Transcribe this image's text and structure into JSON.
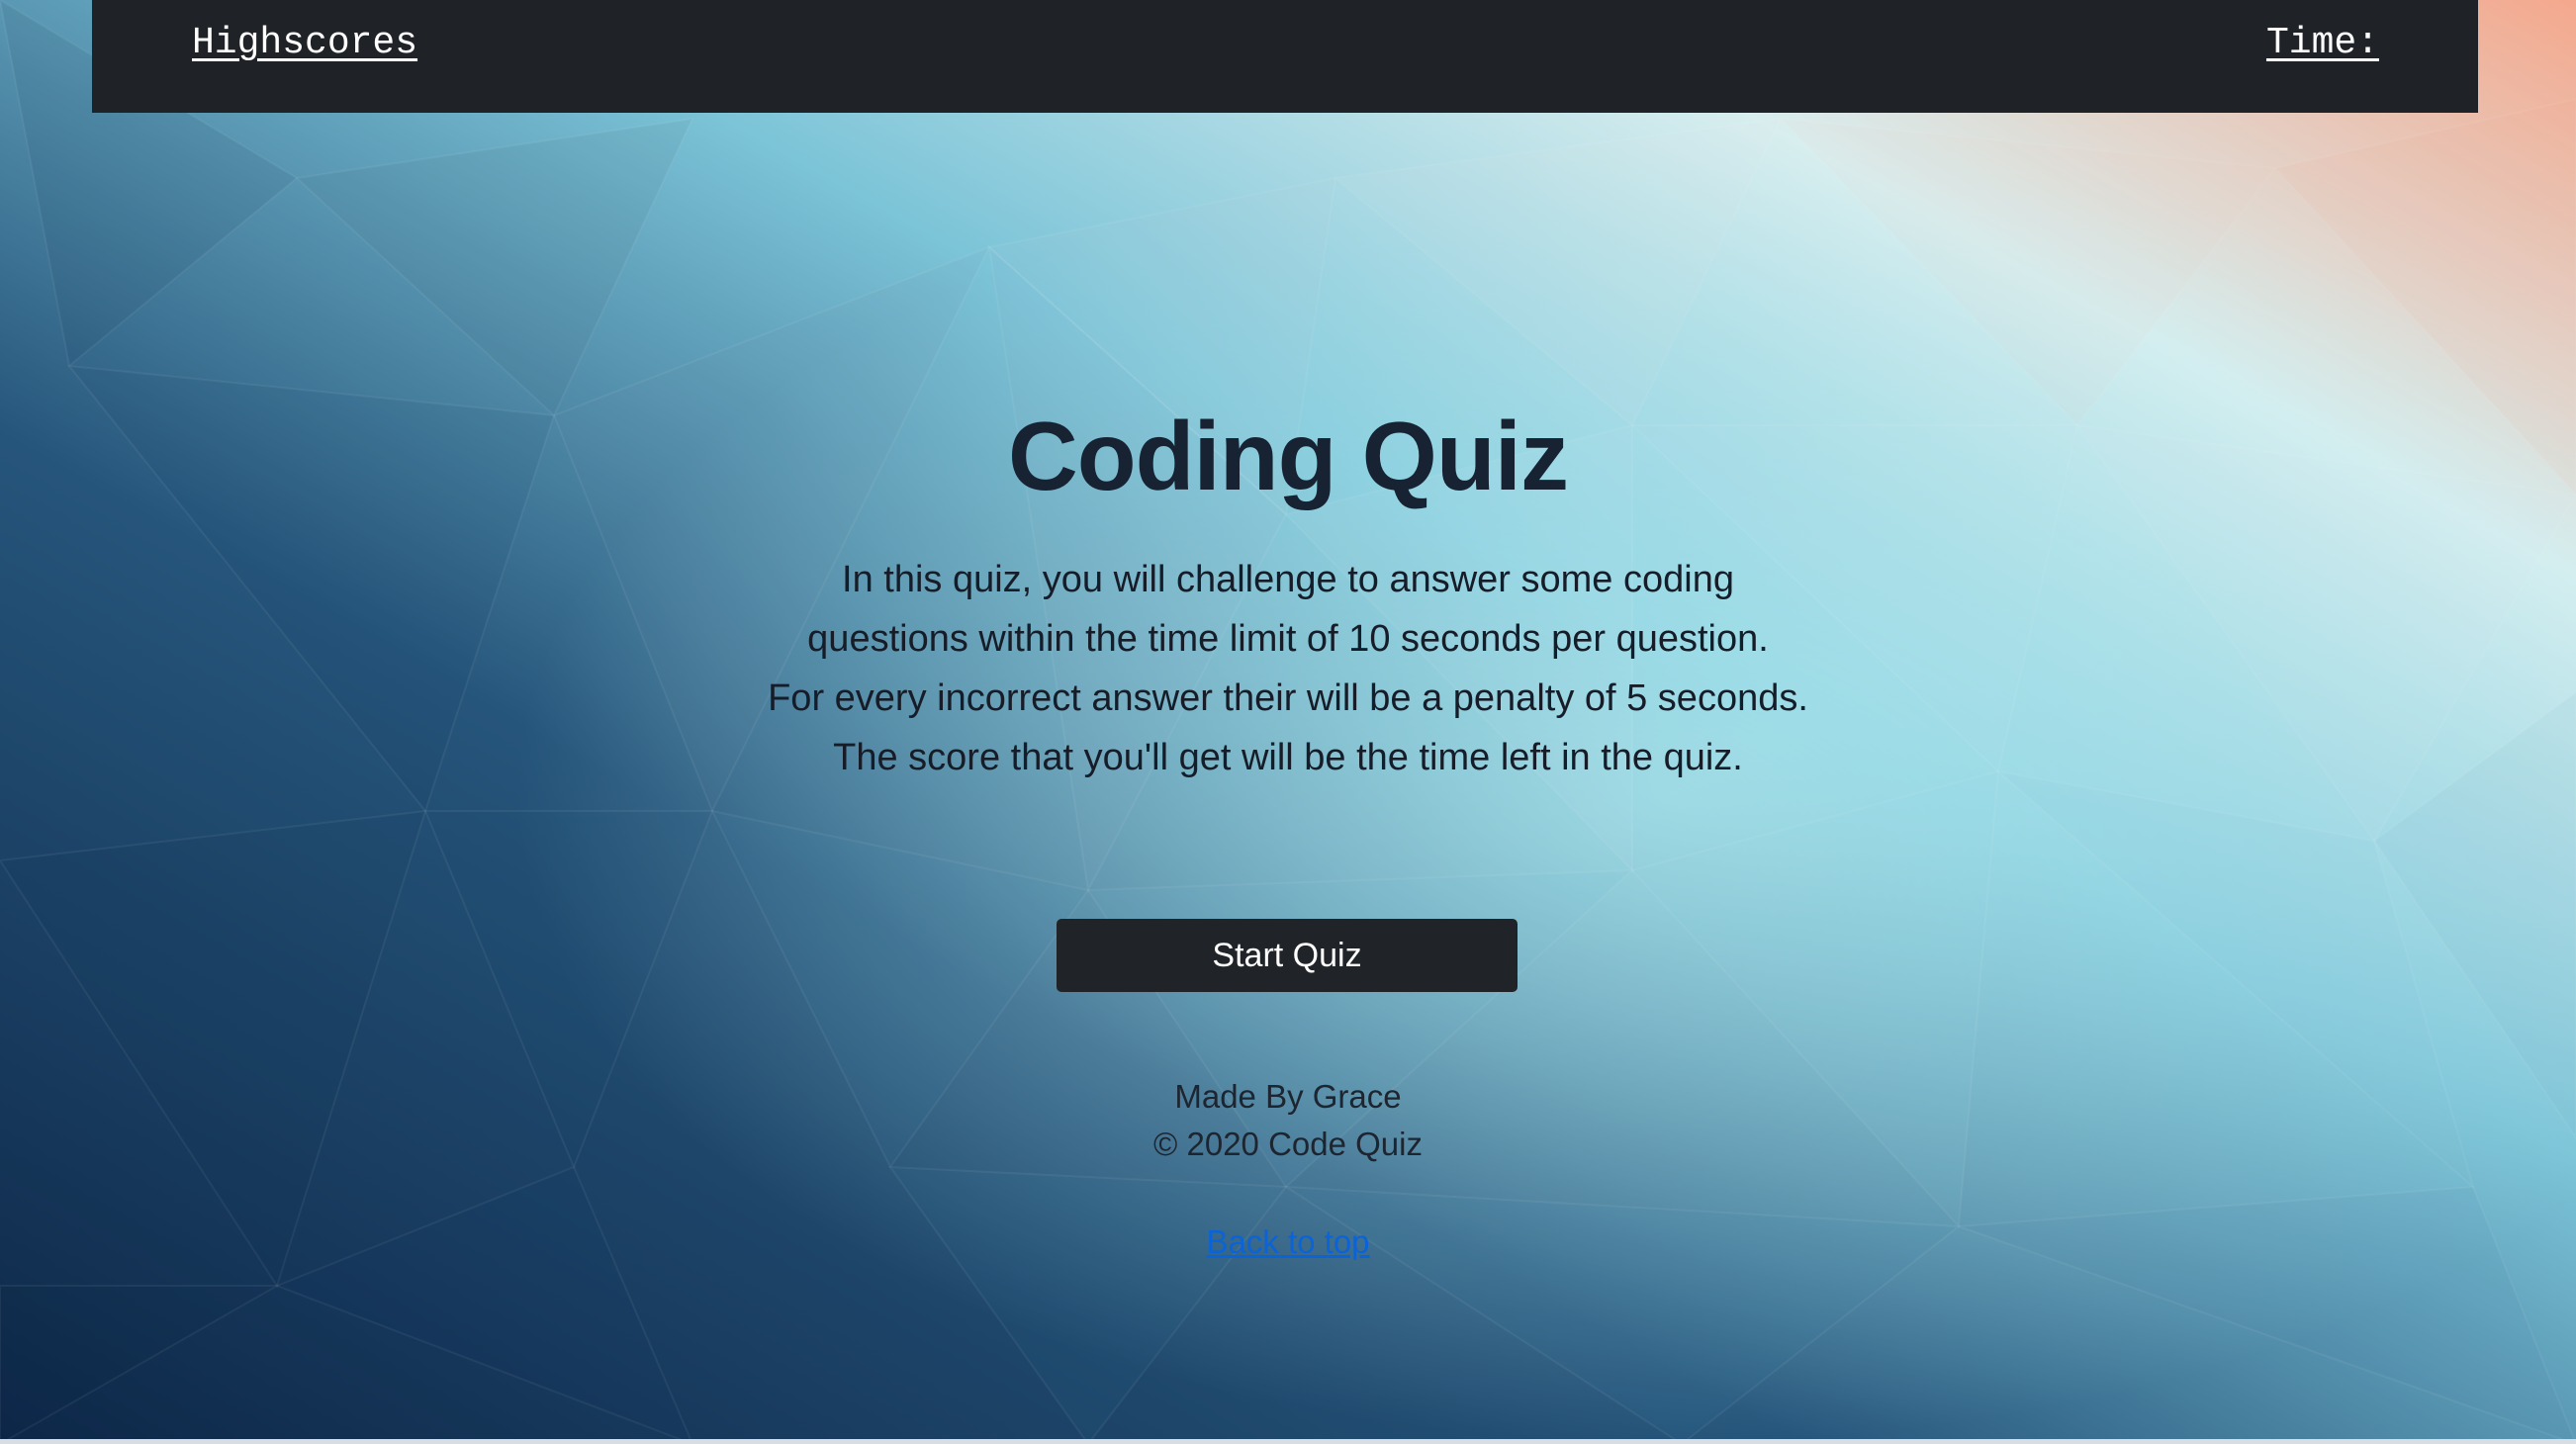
{
  "nav": {
    "highscores_label": "Highscores",
    "time_label": "Time:"
  },
  "main": {
    "title": "Coding Quiz",
    "description_lines": [
      "In this quiz, you will challenge to answer some coding",
      "questions within the time limit of 10 seconds per question.",
      "For every incorrect answer their will be a penalty of 5 seconds.",
      "The score that you'll get will be the time left in the quiz."
    ],
    "start_button_label": "Start Quiz"
  },
  "footer": {
    "made_by": "Made By Grace",
    "copyright": "© 2020 Code Quiz",
    "back_to_top_label": "Back to top"
  },
  "colors": {
    "navbar_bg": "#1f2226",
    "button_bg": "#202428",
    "link_color": "#0a63d8"
  }
}
